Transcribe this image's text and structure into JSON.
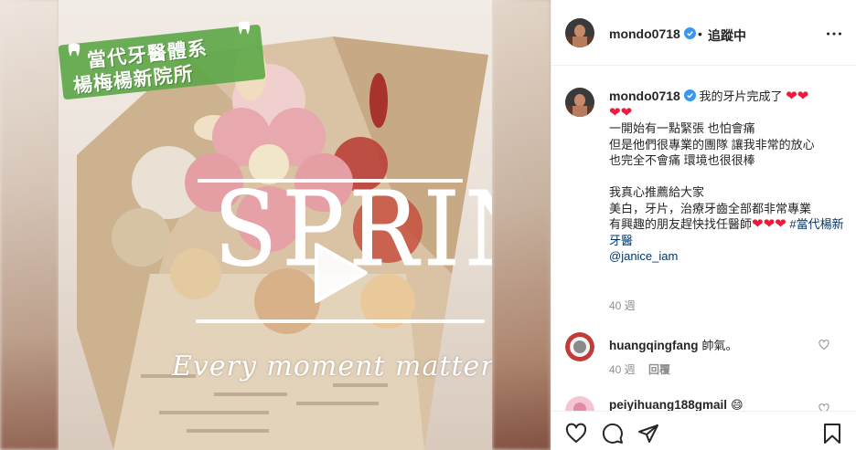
{
  "media": {
    "clinic_tag_line1": "當代牙醫體系",
    "clinic_tag_line2": "楊梅楊新院所",
    "overlay_title": "SPRING",
    "overlay_tagline": "Every moment matters",
    "play_icon": "play-icon",
    "tooth_icon": "tooth-icon"
  },
  "header": {
    "username": "mondo0718",
    "separator": "•",
    "follow_status": "追蹤中",
    "verified_icon": "verified-badge-icon",
    "more_icon": "more-options-icon"
  },
  "caption": {
    "username": "mondo0718",
    "heart": "❤",
    "first_line": "我的牙片完成了",
    "lines": [
      "一開始有一點緊張 也怕會痛",
      "但是他們很專業的團隊 讓我非常的放心",
      "也完全不會痛 環境也很很棒",
      "",
      "我真心推薦給大家",
      "美白，牙片，治療牙齒全部都非常專業",
      "有興趣的朋友趕快找任醫師"
    ],
    "hashtag": "#當代楊新牙醫",
    "mention": "@janice_iam",
    "time": "40 週"
  },
  "comments": [
    {
      "username": "huangqingfang",
      "text": "帥氣。",
      "time": "40 週",
      "reply_label": "回覆"
    },
    {
      "username": "peiyihuang188gmail",
      "text": "😄"
    }
  ],
  "actions": {
    "like_icon": "heart-outline-icon",
    "comment_icon": "comment-icon",
    "share_icon": "share-icon",
    "save_icon": "bookmark-icon"
  },
  "colors": {
    "verified": "#3897f0",
    "heart": "#ed1a3b",
    "link": "#00376b",
    "muted": "#8e8e8e",
    "clinic_tag": "#5fa84a"
  }
}
